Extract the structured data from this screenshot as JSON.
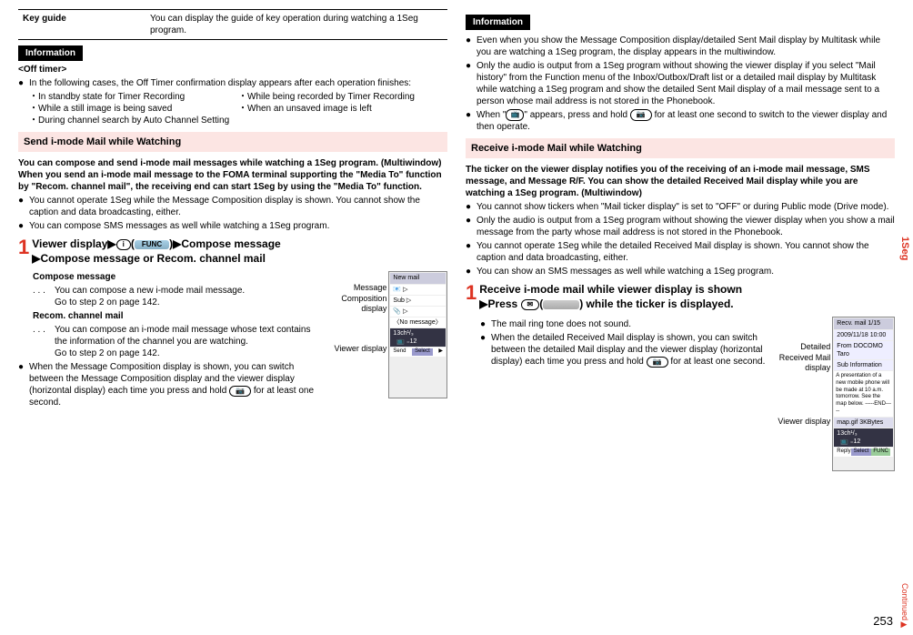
{
  "left": {
    "key_guide_label": "Key guide",
    "key_guide_text": "You can display the guide of key operation during watching a 1Seg program.",
    "info_label": "Information",
    "off_timer_heading": "<Off timer>",
    "off_timer_intro": "In the following cases, the Off Timer confirmation display appears after each operation finishes:",
    "off_timer_items": [
      "In standby state for Timer Recording",
      "While being recorded by Timer Recording",
      "While a still image is being saved",
      "When an unsaved image is left",
      "During channel search by Auto Channel Setting"
    ],
    "send_header": "Send i-mode Mail while Watching",
    "send_p1": "You can compose and send i-mode mail messages while watching a 1Seg program. (Multiwindow)",
    "send_p2": "When you send an i-mode mail message to the FOMA terminal supporting the \"Media To\" function by \"Recom. channel mail\", the receiving end can start 1Seg by using the \"Media To\" function.",
    "send_b1": "You cannot operate 1Seg while the Message Composition display is shown. You cannot show the caption and data broadcasting, either.",
    "send_b2": "You can compose SMS messages as well while watching a 1Seg program.",
    "step1_a": "Viewer display",
    "step1_func": "FUNC",
    "step1_b": "Compose message",
    "step1_c": "Compose message or Recom. channel mail",
    "compose_label": "Compose message",
    "compose_text": "You can compose a new i-mode mail message.",
    "compose_goto": "Go to step 2 on page 142.",
    "recom_label": "Recom. channel mail",
    "recom_text": "You can compose an i-mode mail message whose text contains the information of the channel you are watching.",
    "recom_goto": "Go to step 2 on page 142.",
    "msg_comp_label": "Message Composition display",
    "viewer_label": "Viewer display",
    "send_b3": "When the Message Composition display is shown, you can switch between the Message Composition display and the viewer display (horizontal display) each time you press and hold ",
    "send_b3_end": " for at least one second.",
    "screen_newmail": "New mail",
    "screen_nomsg": "〈No message〉"
  },
  "right": {
    "info_label": "Information",
    "r_b1": "Even when you show the Message Composition display/detailed Sent Mail display by Multitask while you are watching a 1Seg program, the display appears in the multiwindow.",
    "r_b2": "Only the audio is output from a 1Seg program without showing the viewer display if you select \"Mail history\" from the Function menu of the Inbox/Outbox/Draft list or a detailed mail display by Multitask while watching a 1Seg program and show the detailed Sent Mail display of a mail message sent to a person whose mail address is not stored in the Phonebook.",
    "r_b3_a": "When \"",
    "r_b3_b": "\" appears, press and hold ",
    "r_b3_c": " for at least one second to switch to the viewer display and then operate.",
    "recv_header": "Receive i-mode Mail while Watching",
    "recv_p1": "The ticker on the viewer display notifies you of the receiving of an i-mode mail message, SMS message, and Message R/F. You can show the detailed Received Mail display while you are watching a 1Seg program. (Multiwindow)",
    "recv_b1": "You cannot show tickers when \"Mail ticker display\" is set to \"OFF\" or during Public mode (Drive mode).",
    "recv_b2": "Only the audio is output from a 1Seg program without showing the viewer display when you show a mail message from the party whose mail address is not stored in the Phonebook.",
    "recv_b3": "You cannot operate 1Seg while the detailed Received Mail display is shown. You cannot show the caption and data broadcasting, either.",
    "recv_b4": "You can show an SMS messages as well while watching a 1Seg program.",
    "step1_a": "Receive i-mode mail while viewer display is shown",
    "step1_b": "Press ",
    "step1_c": " while the ticker is displayed.",
    "recv_sub1": "The mail ring tone does not sound.",
    "recv_sub2": "When the detailed Received Mail display is shown, you can switch between the detailed Mail display and the viewer display (horizontal display) each time you press and hold ",
    "recv_sub2_end": " for at least one second.",
    "detailed_label": "Detailed Received Mail display",
    "viewer_label": "Viewer display",
    "screen_recv": "Recv. mail       1/15",
    "screen_date": "2009/11/18 10:00",
    "screen_from": "From DOCOMO Taro",
    "screen_sub": "Sub Information",
    "screen_body": "A presentation of a new mobile phone will be made at 10 a.m. tomorrow. See the map below.\n-----END-----",
    "screen_att": "map.gif        3KBytes"
  },
  "side_tab": "1Seg",
  "continued": "Continued",
  "page_num": "253"
}
